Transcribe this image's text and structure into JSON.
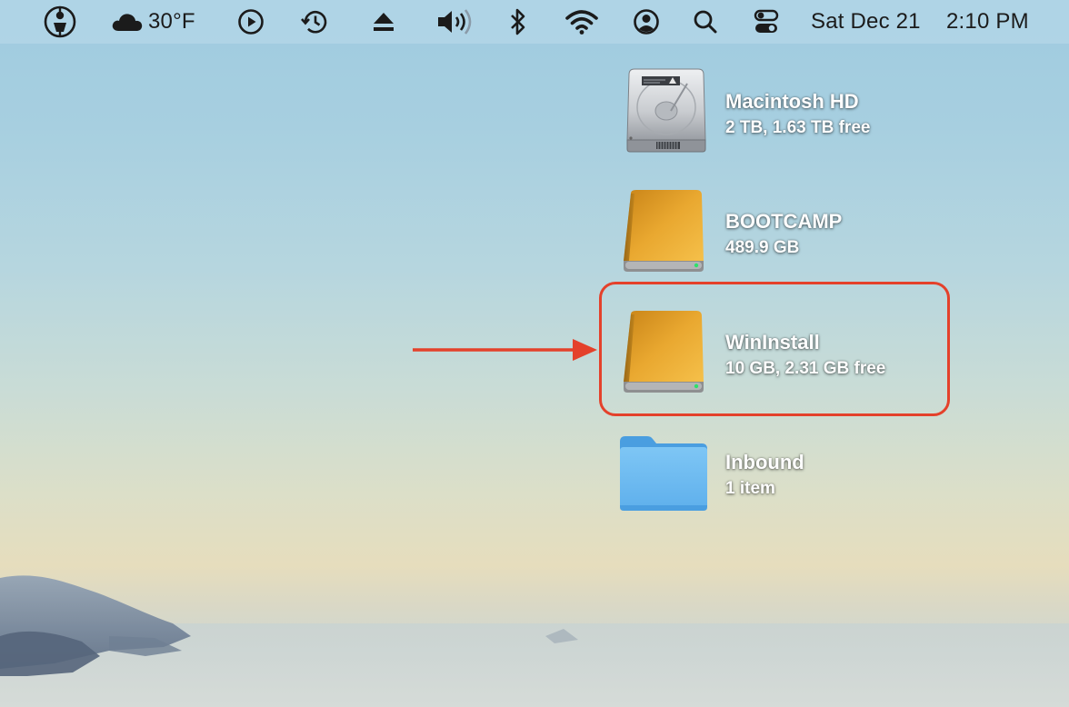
{
  "menubar": {
    "weather": {
      "icon": "cloud-icon",
      "temperature": "30°F"
    },
    "date": "Sat Dec 21",
    "time": "2:10 PM",
    "icons": [
      "app-extra-icon",
      "cloud-icon",
      "play-icon",
      "time-machine-icon",
      "eject-icon",
      "volume-icon",
      "bluetooth-icon",
      "wifi-icon",
      "user-icon",
      "search-icon",
      "control-center-icon"
    ]
  },
  "desktop": {
    "items": [
      {
        "name": "Macintosh HD",
        "info": "2 TB, 1.63 TB free",
        "icon": "internal-drive-icon"
      },
      {
        "name": "BOOTCAMP",
        "info": "489.9 GB",
        "icon": "external-drive-icon"
      },
      {
        "name": "WinInstall",
        "info": "10 GB, 2.31 GB free",
        "icon": "external-drive-icon"
      },
      {
        "name": "Inbound",
        "info": "1 item",
        "icon": "folder-icon"
      }
    ]
  },
  "annotation": {
    "highlight_color": "#e4412b",
    "highlighted_item": "WinInstall"
  }
}
